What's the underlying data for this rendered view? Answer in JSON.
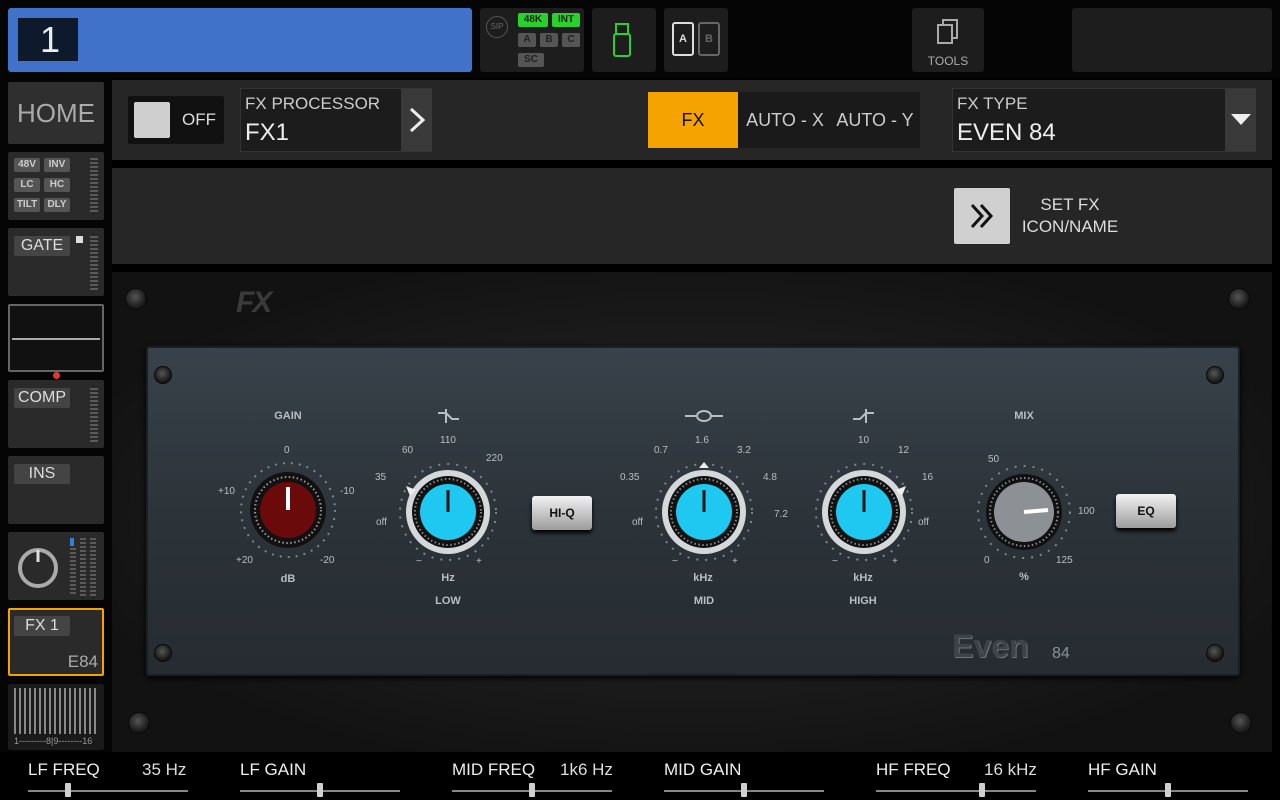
{
  "header": {
    "channel_number": "1",
    "sip": "SIP",
    "sr_48k": "48K",
    "int": "INT",
    "a": "A",
    "b": "B",
    "c": "C",
    "sc": "SC",
    "card_a": "A",
    "card_b": "B",
    "tools": "TOOLS"
  },
  "sidebar": {
    "home": "HOME",
    "tags": [
      "48V",
      "INV",
      "LC",
      "HC",
      "TILT",
      "DLY"
    ],
    "gate": "GATE",
    "comp": "COMP",
    "ins": "INS",
    "fx": "FX 1",
    "fx_sub": "E84",
    "meter_scale": "1---------8|9--------16"
  },
  "toolbar": {
    "off_label": "OFF",
    "fx_processor_label": "FX PROCESSOR",
    "fx_processor_value": "FX1",
    "tab_fx": "FX",
    "tab_auto_x": "AUTO - X",
    "tab_auto_y": "AUTO - Y",
    "fx_type_label": "FX TYPE",
    "fx_type_value": "EVEN 84",
    "set_fx_line1": "SET FX",
    "set_fx_line2": "ICON/NAME"
  },
  "plugin": {
    "logo": "FX",
    "brand": "Even",
    "model": "84",
    "gain": {
      "title": "GAIN",
      "top": "0",
      "l1": "+10",
      "r1": "-10",
      "l2": "+20",
      "r2": "-20",
      "unit": "dB"
    },
    "low": {
      "s1": "60",
      "s2": "110",
      "s3": "220",
      "s4": "35",
      "s5": "off",
      "unit": "Hz",
      "name": "LOW",
      "minus": "−",
      "plus": "+"
    },
    "hiq": "HI-Q",
    "mid": {
      "s1": "0.7",
      "s2": "1.6",
      "s3": "3.2",
      "s4": "0.35",
      "s5": "4.8",
      "s6": "off",
      "s7": "7.2",
      "unit": "kHz",
      "name": "MID",
      "minus": "−",
      "plus": "+"
    },
    "high": {
      "s1": "10",
      "s2": "12",
      "s3": "16",
      "s4": "off",
      "unit": "kHz",
      "name": "HIGH",
      "minus": "−",
      "plus": "+"
    },
    "mix": {
      "title": "MIX",
      "s1": "50",
      "s2": "100",
      "s3": "0",
      "s4": "125",
      "unit": "%"
    },
    "eq": "EQ"
  },
  "params": [
    {
      "label": "LF FREQ",
      "value": "35 Hz",
      "pos": 0.25
    },
    {
      "label": "LF GAIN",
      "value": "",
      "pos": 0.5
    },
    {
      "label": "MID FREQ",
      "value": "1k6 Hz",
      "pos": 0.5
    },
    {
      "label": "MID GAIN",
      "value": "",
      "pos": 0.5
    },
    {
      "label": "HF FREQ",
      "value": "16 kHz",
      "pos": 0.66
    },
    {
      "label": "HF GAIN",
      "value": "",
      "pos": 0.5
    }
  ],
  "colors": {
    "accent": "#f5a300",
    "channel": "#3f72c8",
    "knob_cyan": "#1ec8f0",
    "gain_knob": "#6a0a0a",
    "green": "#2bd12b"
  }
}
